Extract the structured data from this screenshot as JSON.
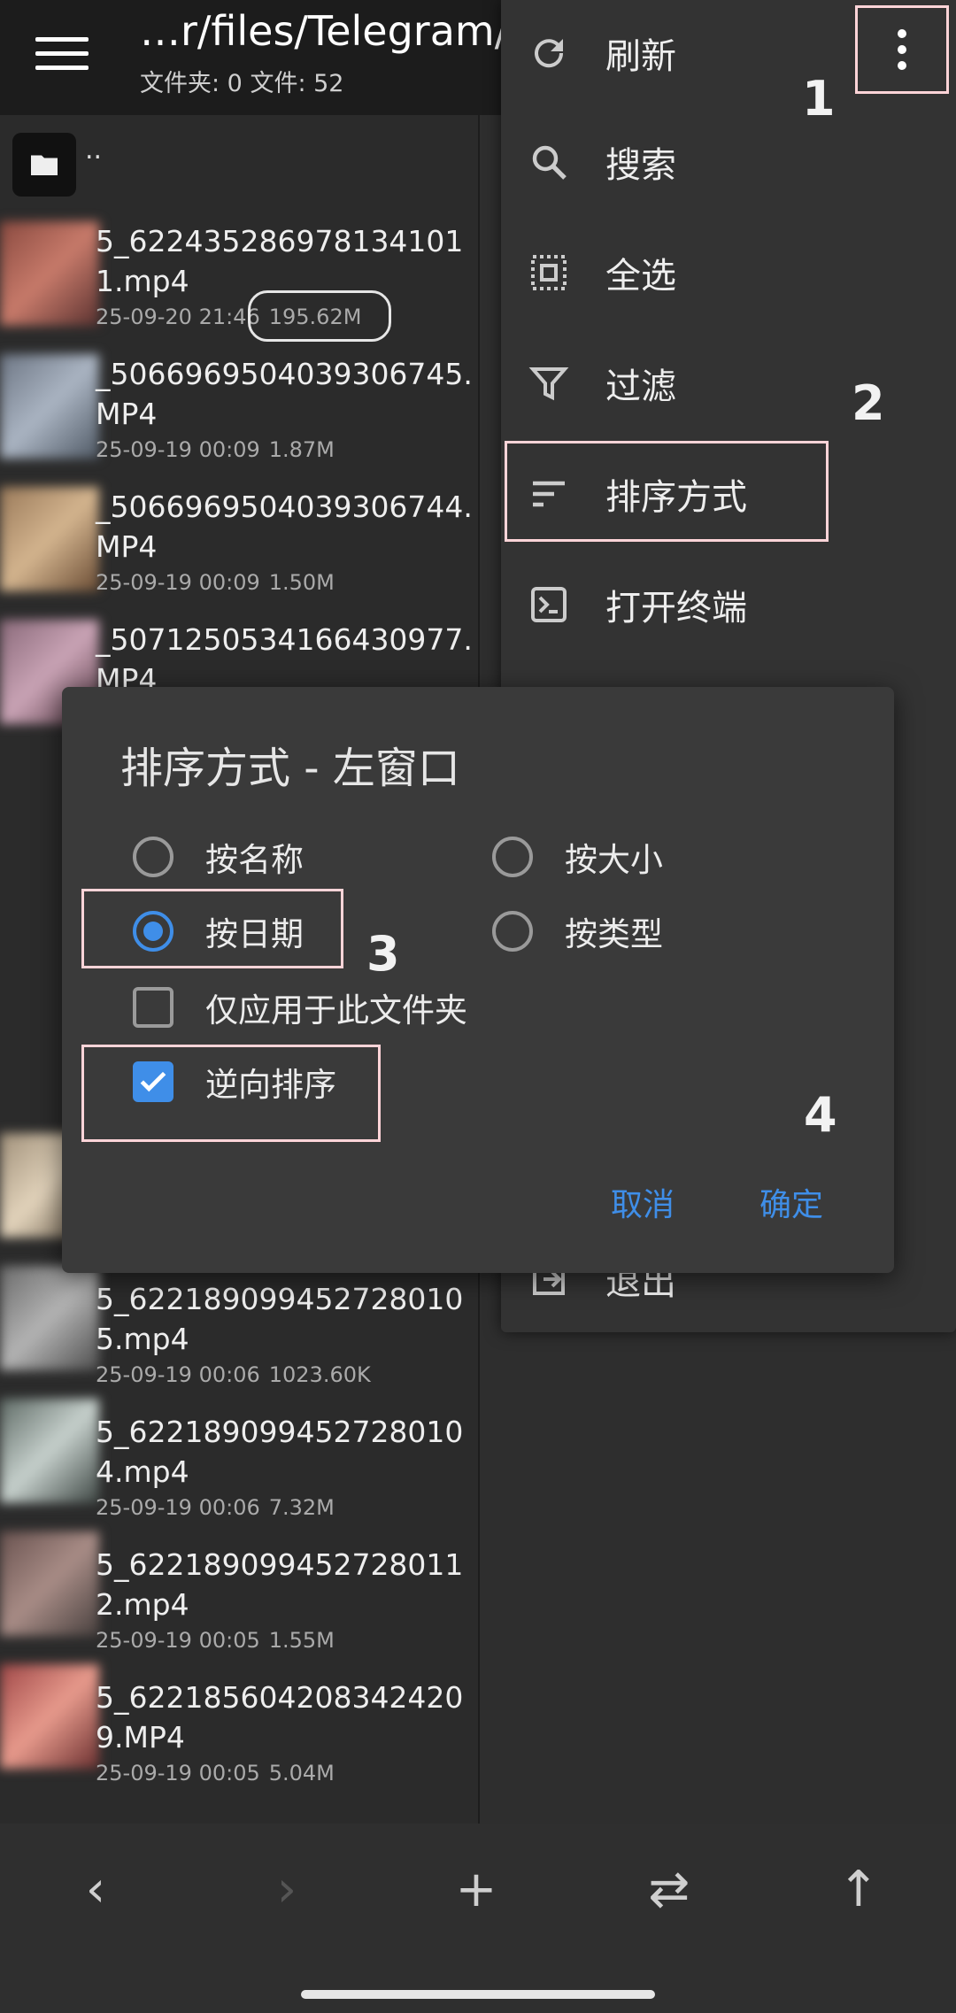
{
  "header": {
    "title": "…r/files/Telegram/",
    "subtitle": "文件夹: 0  文件: 52"
  },
  "left_pane": {
    "parent_label": "..",
    "files": [
      {
        "name": "5_6224352869781341011.mp4",
        "date": "25-09-20 21:46",
        "size": "195.62M"
      },
      {
        "name": "_5066969504039306745.MP4",
        "date": "25-09-19 00:09",
        "size": "1.87M"
      },
      {
        "name": "_5066969504039306744.MP4",
        "date": "25-09-19 00:09",
        "size": "1.50M"
      },
      {
        "name": "_5071250534166430977.MP4",
        "date": "",
        "size": ""
      },
      {
        "name": "5_6221890994527280105.mp4",
        "date": "25-09-19 00:06",
        "size": "1023.60K"
      },
      {
        "name": "5_6221890994527280104.mp4",
        "date": "25-09-19 00:06",
        "size": "7.32M"
      },
      {
        "name": "5_6221890994527280112.mp4",
        "date": "25-09-19 00:05",
        "size": "1.55M"
      },
      {
        "name": "5_6221856042083424209.MP4",
        "date": "25-09-19 00:05",
        "size": "5.04M"
      }
    ]
  },
  "popup_menu": {
    "items": [
      {
        "label": "刷新",
        "icon": "refresh-icon"
      },
      {
        "label": "搜索",
        "icon": "search-icon"
      },
      {
        "label": "全选",
        "icon": "select-all-icon"
      },
      {
        "label": "过滤",
        "icon": "filter-icon"
      },
      {
        "label": "排序方式",
        "icon": "sort-icon"
      },
      {
        "label": "打开终端",
        "icon": "terminal-icon"
      },
      {
        "label": "退出",
        "icon": "exit-icon"
      }
    ]
  },
  "dialog": {
    "title": "排序方式 - 左窗口",
    "options": {
      "by_name": "按名称",
      "by_size": "按大小",
      "by_date": "按日期",
      "by_type": "按类型"
    },
    "selected_sort": "按日期",
    "checkbox_folder_only": {
      "label": "仅应用于此文件夹",
      "checked": false
    },
    "checkbox_reverse": {
      "label": "逆向排序",
      "checked": true
    },
    "cancel": "取消",
    "ok": "确定"
  },
  "annotations": {
    "step1": "1",
    "step2": "2",
    "step3": "3",
    "step4": "4"
  },
  "bottom_bar": {
    "icons": [
      "back-icon",
      "forward-icon",
      "add-icon",
      "swap-icon",
      "up-icon"
    ]
  },
  "colors": {
    "accent": "#3f8ee8",
    "highlight": "#ffd4d8",
    "dialog_bg": "#3a3a3a"
  }
}
